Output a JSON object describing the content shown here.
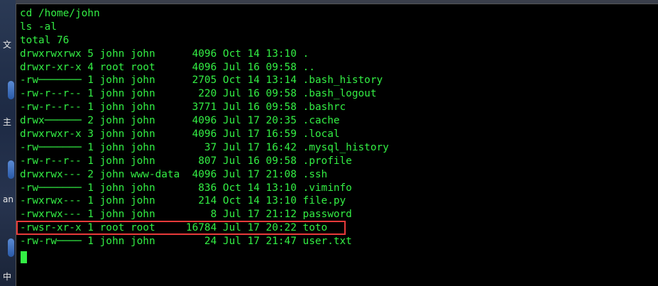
{
  "desktop": {
    "glyphs": [
      "文",
      "主",
      "an",
      "中"
    ]
  },
  "terminal": {
    "lines": [
      "cd /home/john",
      "ls -al",
      "total 76",
      "drwxrwxrwx 5 john john      4096 Oct 14 13:10 .",
      "drwxr-xr-x 4 root root      4096 Jul 16 09:58 ..",
      "-rw─────── 1 john john      2705 Oct 14 13:14 .bash_history",
      "-rw-r--r-- 1 john john       220 Jul 16 09:58 .bash_logout",
      "-rw-r--r-- 1 john john      3771 Jul 16 09:58 .bashrc",
      "drwx────── 2 john john      4096 Jul 17 20:35 .cache",
      "drwxrwxr-x 3 john john      4096 Jul 17 16:59 .local",
      "-rw─────── 1 john john        37 Jul 17 16:42 .mysql_history",
      "-rw-r--r-- 1 john john       807 Jul 16 09:58 .profile",
      "drwxrwx--- 2 john www-data  4096 Jul 17 21:08 .ssh",
      "-rw─────── 1 john john       836 Oct 14 13:10 .viminfo",
      "-rwxrwx--- 1 john john       214 Oct 14 13:10 file.py",
      "-rwxrwx--- 1 john john         8 Jul 17 21:12 password",
      "-rwsr-xr-x 1 root root     16784 Jul 17 20:22 toto",
      "-rw-rw──── 1 john john        24 Jul 17 21:47 user.txt"
    ],
    "highlighted_line_index": 16,
    "colors": {
      "text": "#33ee44",
      "background": "#000000",
      "highlight": "#e83a3a"
    }
  }
}
